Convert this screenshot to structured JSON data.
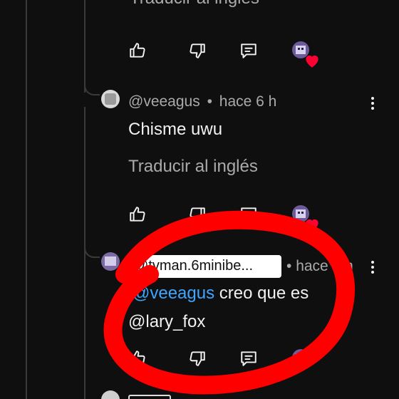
{
  "top_comment": {
    "translate_label": "Traducir al inglés"
  },
  "comment1": {
    "handle": "@veeagus",
    "separator": "•",
    "time": "hace 6 h",
    "body": "Chisme uwu",
    "translate_label": "Traducir al inglés"
  },
  "comment2": {
    "handle": "@tvman.6minibe...",
    "separator": "•",
    "time": "hace 6 h",
    "mention": "@veeagus",
    "body_rest": " creo que es",
    "body_line2": "@lary_fox"
  },
  "icons": {
    "like": "thumbs-up-icon",
    "dislike": "thumbs-down-icon",
    "reply": "comment-reply-icon",
    "creator_heart": "creator-heart-icon",
    "more": "more-vertical-icon"
  },
  "colors": {
    "background": "#0f0f0f",
    "text": "#f1f1f1",
    "secondary": "#aaaaaa",
    "mention": "#3ea6ff",
    "annotation": "#ff0000",
    "heart": "#ff0033"
  }
}
